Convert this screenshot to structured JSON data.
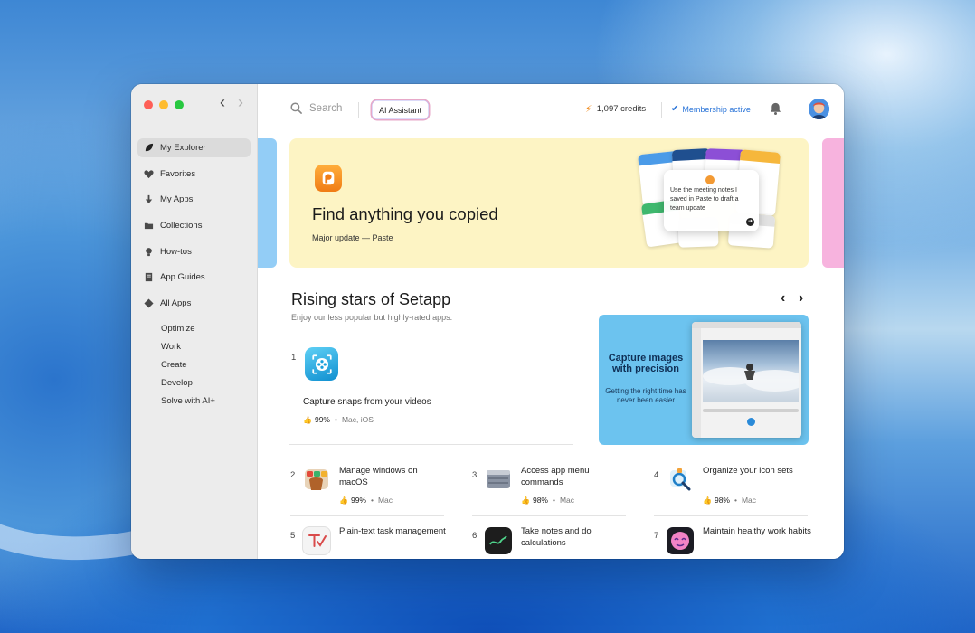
{
  "sidebar": {
    "items": [
      {
        "label": "My Explorer",
        "icon": "leaf-icon"
      },
      {
        "label": "Favorites",
        "icon": "heart-icon"
      },
      {
        "label": "My Apps",
        "icon": "download-arrow-icon"
      },
      {
        "label": "Collections",
        "icon": "folder-icon"
      },
      {
        "label": "How-tos",
        "icon": "lightbulb-icon"
      },
      {
        "label": "App Guides",
        "icon": "book-icon"
      },
      {
        "label": "All Apps",
        "icon": "diamond-icon"
      }
    ],
    "subitems": [
      "Optimize",
      "Work",
      "Create",
      "Develop",
      "Solve with AI+"
    ]
  },
  "topbar": {
    "search_placeholder": "Search",
    "ai_button": "AI Assistant",
    "credits": "1,097 credits",
    "membership": "Membership active"
  },
  "hero": {
    "title": "Find anything you copied",
    "subtitle": "Major update — Paste",
    "tooltip_text": "Use the meeting notes I saved in Paste to draft a team update"
  },
  "section": {
    "title": "Rising stars of Setapp",
    "subtitle": "Enjoy our less popular but highly-rated apps."
  },
  "featured": {
    "number": "1",
    "description": "Capture snaps from your videos",
    "rating": "99%",
    "platforms": "Mac, iOS"
  },
  "promo": {
    "title": "Capture images with precision",
    "subtitle": "Getting the right time has never been easier"
  },
  "apps": [
    {
      "number": "2",
      "description": "Manage windows on macOS",
      "rating": "99%",
      "platforms": "Mac"
    },
    {
      "number": "3",
      "description": "Access app menu commands",
      "rating": "98%",
      "platforms": "Mac"
    },
    {
      "number": "4",
      "description": "Organize your icon sets",
      "rating": "98%",
      "platforms": "Mac"
    },
    {
      "number": "5",
      "description": "Plain-text task management"
    },
    {
      "number": "6",
      "description": "Take notes and do calculations"
    },
    {
      "number": "7",
      "description": "Maintain healthy work habits"
    }
  ],
  "meta_separator": "•",
  "colors": {
    "accent_blue": "#2a74d8",
    "hero_background": "#fdf4c4",
    "promo_background": "#6cc3ef",
    "credits_bolt": "#f08a1c"
  }
}
